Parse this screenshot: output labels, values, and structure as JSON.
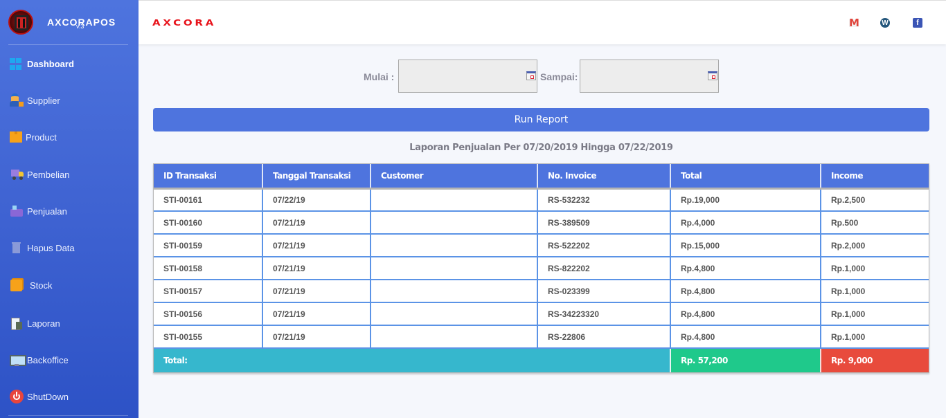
{
  "sidebar": {
    "app_name": "AXCORAPOS",
    "version": "v.3",
    "items": [
      {
        "label": "Dashboard",
        "icon": "windows-icon",
        "active": true
      },
      {
        "label": "Supplier",
        "icon": "supplier-icon"
      },
      {
        "label": "Product",
        "icon": "box-icon"
      },
      {
        "label": "Pembelian",
        "icon": "truck-icon"
      },
      {
        "label": "Penjualan",
        "icon": "cash-register-icon"
      },
      {
        "label": "Hapus Data",
        "icon": "trash-icon"
      },
      {
        "label": "Stock",
        "icon": "stock-box-icon"
      },
      {
        "label": "Laporan",
        "icon": "report-calculator-icon"
      },
      {
        "label": "Backoffice",
        "icon": "monitor-icon"
      },
      {
        "label": "ShutDown",
        "icon": "power-icon"
      }
    ]
  },
  "topbar": {
    "brand": "AXCORA",
    "social": [
      {
        "name": "gmail-icon",
        "glyph": "M"
      },
      {
        "name": "wordpress-icon",
        "glyph": "W"
      },
      {
        "name": "facebook-icon",
        "glyph": "f"
      }
    ]
  },
  "filter": {
    "start_label": "Mulai :",
    "end_label": "Sampai:",
    "start_value": "",
    "end_value": "",
    "run_label": "Run Report"
  },
  "report": {
    "title": "Laporan Penjualan Per 07/20/2019 Hingga 07/22/2019",
    "columns": [
      "ID Transaksi",
      "Tanggal Transaksi",
      "Customer",
      "No. Invoice",
      "Total",
      "Income"
    ],
    "rows": [
      [
        "STI-00161",
        "07/22/19",
        "",
        "RS-532232",
        "Rp.19,000",
        "Rp.2,500"
      ],
      [
        "STI-00160",
        "07/21/19",
        "",
        "RS-389509",
        "Rp.4,000",
        "Rp.500"
      ],
      [
        "STI-00159",
        "07/21/19",
        "",
        "RS-522202",
        "Rp.15,000",
        "Rp.2,000"
      ],
      [
        "STI-00158",
        "07/21/19",
        "",
        "RS-822202",
        "Rp.4,800",
        "Rp.1,000"
      ],
      [
        "STI-00157",
        "07/21/19",
        "",
        "RS-023399",
        "Rp.4,800",
        "Rp.1,000"
      ],
      [
        "STI-00156",
        "07/21/19",
        "",
        "RS-34223320",
        "Rp.4,800",
        "Rp.1,000"
      ],
      [
        "STI-00155",
        "07/21/19",
        "",
        "RS-22806",
        "Rp.4,800",
        "Rp.1,000"
      ]
    ],
    "total_label": "Total:",
    "total_sum": "Rp. 57,200",
    "income_sum": "Rp. 9,000"
  },
  "colors": {
    "accent": "#4e74de",
    "total_label_bg": "#36b7cd",
    "total_sum_bg": "#1fc98b",
    "income_sum_bg": "#e84b3c",
    "brand_red": "#e8141c"
  }
}
